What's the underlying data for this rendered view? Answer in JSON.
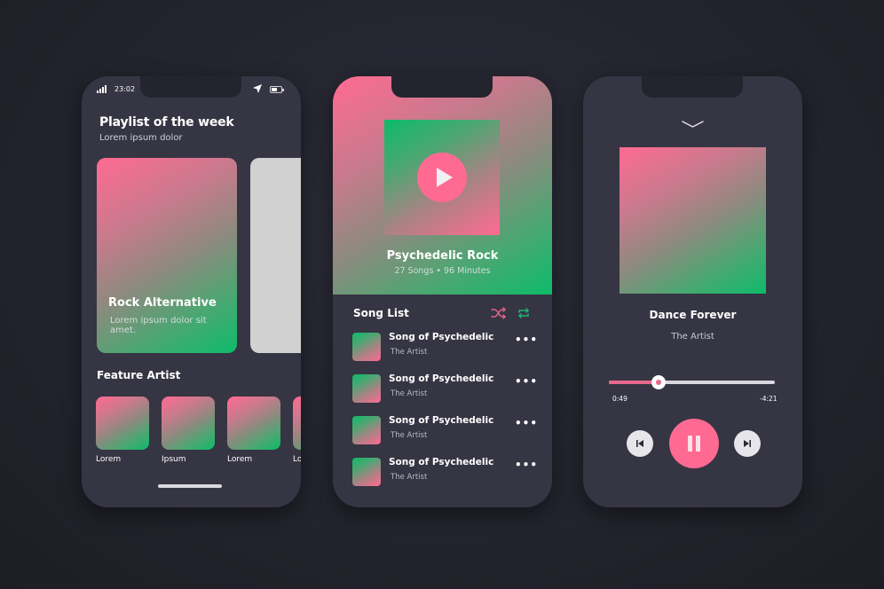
{
  "colors": {
    "pink": "#ff6a92",
    "green": "#0dbb6a",
    "phone_bg": "#363543",
    "page_bg": "#23232d"
  },
  "phone1": {
    "status": {
      "time": "23:02",
      "icons": [
        "signal-icon",
        "location-arrow-icon",
        "battery-icon"
      ]
    },
    "title": "Playlist of the week",
    "subtitle": "Lorem ipsum dolor",
    "featured_card": {
      "title": "Rock Alternative",
      "subtitle": "Lorem ipsum dolor sit amet."
    },
    "feature_artist_heading": "Feature Artist",
    "artists": [
      {
        "name": "Lorem"
      },
      {
        "name": "Ipsum"
      },
      {
        "name": "Lorem"
      },
      {
        "name": "Lorem"
      }
    ]
  },
  "phone2": {
    "album_title": "Psychedelic Rock",
    "album_meta": "27 Songs • 96 Minutes",
    "song_list_heading": "Song List",
    "icons": [
      "play-icon",
      "shuffle-icon",
      "repeat-icon",
      "more-icon"
    ],
    "songs": [
      {
        "title": "Song of Psychedelic",
        "artist": "The Artist",
        "more": "•••"
      },
      {
        "title": "Song of Psychedelic",
        "artist": "The Artist",
        "more": "•••"
      },
      {
        "title": "Song of Psychedelic",
        "artist": "The Artist",
        "more": "•••"
      },
      {
        "title": "Song of Psychedelic",
        "artist": "The Artist",
        "more": "•••"
      }
    ]
  },
  "phone3": {
    "track_title": "Dance Forever",
    "track_artist": "The Artist",
    "elapsed": "0:49",
    "remaining": "-4:21",
    "progress_fraction": 0.3,
    "icons": [
      "chevron-down-icon",
      "previous-icon",
      "pause-icon",
      "next-icon"
    ]
  }
}
